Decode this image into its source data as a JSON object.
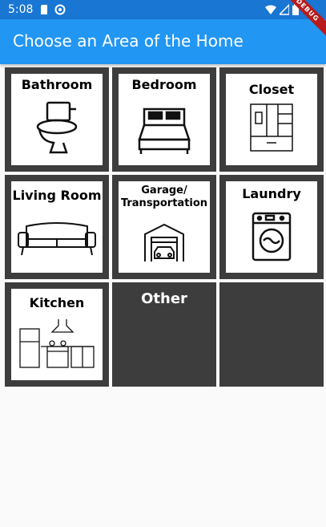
{
  "status": {
    "time": "5:08"
  },
  "debug_label": "DEBUG",
  "appbar": {
    "title": "Choose an Area of the Home"
  },
  "tiles": [
    {
      "label": "Bathroom",
      "icon": "toilet-icon"
    },
    {
      "label": "Bedroom",
      "icon": "bed-icon"
    },
    {
      "label": "Closet",
      "icon": "closet-icon"
    },
    {
      "label": "Living Room",
      "icon": "sofa-icon"
    },
    {
      "label": "Garage/",
      "label2": "Transportation",
      "icon": "garage-icon"
    },
    {
      "label": "Laundry",
      "icon": "washing-machine-icon"
    },
    {
      "label": "Kitchen",
      "icon": "kitchen-icon"
    },
    {
      "label": "Other"
    }
  ],
  "colors": {
    "appbar": "#2196f3",
    "statusbar": "#1976d2",
    "tile_border": "#3d3d3d"
  }
}
